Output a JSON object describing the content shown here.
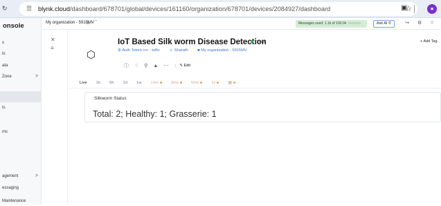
{
  "browser": {
    "url_domain": "blynk.cloud",
    "url_path": "/dashboard/678701/global/devices/161160/organization/678701/devices/2084927/dashboard"
  },
  "sidebar": {
    "title": "onsole",
    "items": [
      {
        "label": "s"
      },
      {
        "label": "ts"
      },
      {
        "label": "ata"
      },
      {
        "label": "Zone"
      },
      {
        "label": ""
      },
      {
        "label": "ts"
      },
      {
        "label": "ms"
      },
      {
        "label": "agement"
      },
      {
        "label": "essaging"
      },
      {
        "label": "Maintenance"
      }
    ]
  },
  "appbar": {
    "organization": "My organization - 5915MV",
    "messages": "Messages used: 1.1k of 100.0k",
    "ask_ai": "Ask AI"
  },
  "device": {
    "title": "IoT Based Silk worm Disease Detection",
    "status": "Online",
    "auth_token": "Auth Token •••• - tuBv",
    "owner": "Sharath",
    "org": "My organization - 5915MV",
    "edit_label": "Edit",
    "add_tag_label": "Add Tag"
  },
  "time_tabs": [
    {
      "label": "Live",
      "active": true,
      "pro": false
    },
    {
      "label": "1h",
      "active": false,
      "pro": false
    },
    {
      "label": "6h",
      "active": false,
      "pro": false
    },
    {
      "label": "1d",
      "active": false,
      "pro": false
    },
    {
      "label": "1w",
      "active": false,
      "pro": false
    },
    {
      "label": "1mo",
      "active": false,
      "pro": true
    },
    {
      "label": "3mo",
      "active": false,
      "pro": true
    },
    {
      "label": "6mo",
      "active": false,
      "pro": true
    },
    {
      "label": "1y",
      "active": false,
      "pro": true
    },
    {
      "label": "",
      "active": false,
      "pro": true
    }
  ],
  "widget": {
    "title": "Silkworm Status",
    "value": "Total: 2; Healthy: 1; Grasserie: 1"
  },
  "colors": {
    "online": "#3bb54a",
    "link": "#3a76c9",
    "profile": "#7b2fd1",
    "pro_dot": "#f0a24a"
  }
}
